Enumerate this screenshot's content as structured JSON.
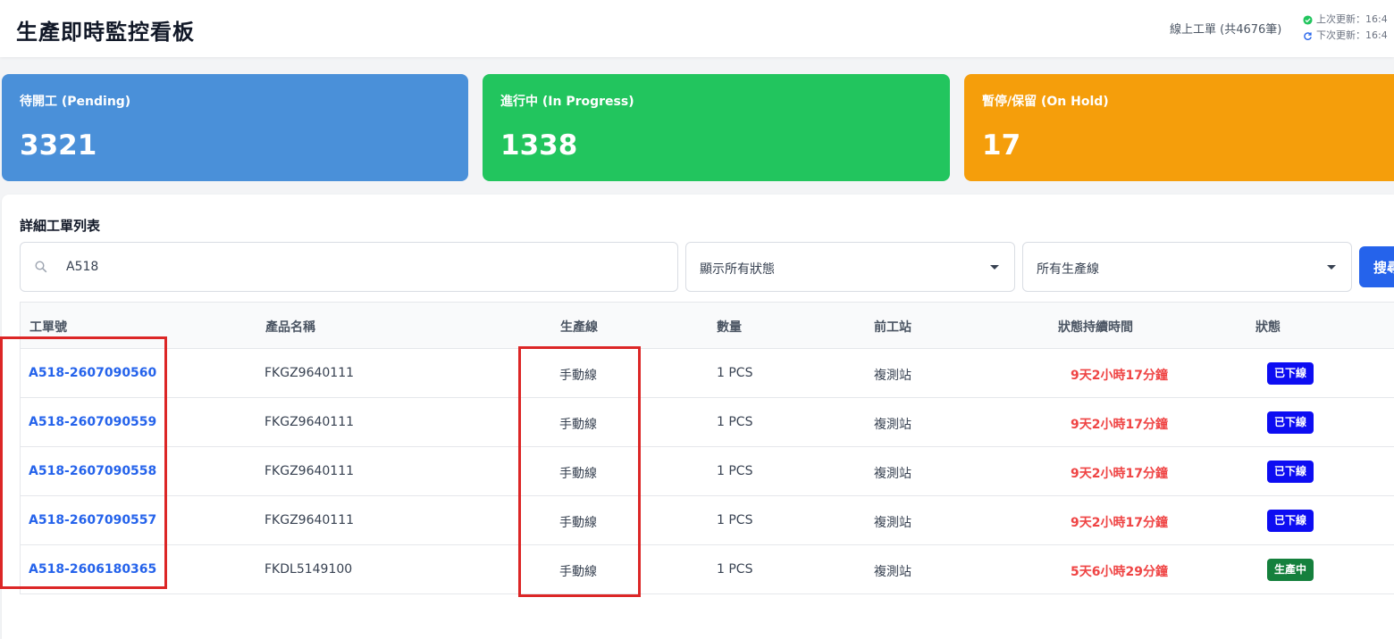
{
  "header": {
    "title": "生產即時監控看板",
    "online_orders": "線上工單 (共4676筆)",
    "last_update": "上次更新：16:4",
    "next_update": "下次更新：16:4"
  },
  "summary_cards": [
    {
      "label": "待開工 (Pending)",
      "value": "3321",
      "color": "#4a90d9"
    },
    {
      "label": "進行中 (In Progress)",
      "value": "1338",
      "color": "#22c55e"
    },
    {
      "label": "暫停/保留 (On Hold)",
      "value": "17",
      "color": "#f59e0b"
    }
  ],
  "panel": {
    "title": "詳細工單列表",
    "search_value": "A518",
    "status_filter": "顯示所有狀態",
    "line_filter": "所有生產線",
    "search_button": "搜尋"
  },
  "table": {
    "columns": [
      "工單號",
      "產品名稱",
      "生產線",
      "數量",
      "前工站",
      "狀態持續時間",
      "狀態"
    ],
    "rows": [
      {
        "work_order": "A518-2607090560",
        "product": "FKGZ9640111",
        "line": "手動線",
        "qty": "1 PCS",
        "prev_station": "複測站",
        "duration": "9天2小時17分鐘",
        "status": "已下線",
        "status_color": "#0d0df2"
      },
      {
        "work_order": "A518-2607090559",
        "product": "FKGZ9640111",
        "line": "手動線",
        "qty": "1 PCS",
        "prev_station": "複測站",
        "duration": "9天2小時17分鐘",
        "status": "已下線",
        "status_color": "#0d0df2"
      },
      {
        "work_order": "A518-2607090558",
        "product": "FKGZ9640111",
        "line": "手動線",
        "qty": "1 PCS",
        "prev_station": "複測站",
        "duration": "9天2小時17分鐘",
        "status": "已下線",
        "status_color": "#0d0df2"
      },
      {
        "work_order": "A518-2607090557",
        "product": "FKGZ9640111",
        "line": "手動線",
        "qty": "1 PCS",
        "prev_station": "複測站",
        "duration": "9天2小時17分鐘",
        "status": "已下線",
        "status_color": "#0d0df2"
      },
      {
        "work_order": "A518-2606180365",
        "product": "FKDL5149100",
        "line": "手動線",
        "qty": "1 PCS",
        "prev_station": "複測站",
        "duration": "5天6小時29分鐘",
        "status": "生產中",
        "status_color": "#15803d"
      }
    ]
  },
  "colors": {
    "highlight_box": "#dc2626",
    "link": "#2563eb",
    "duration": "#ef4444"
  }
}
